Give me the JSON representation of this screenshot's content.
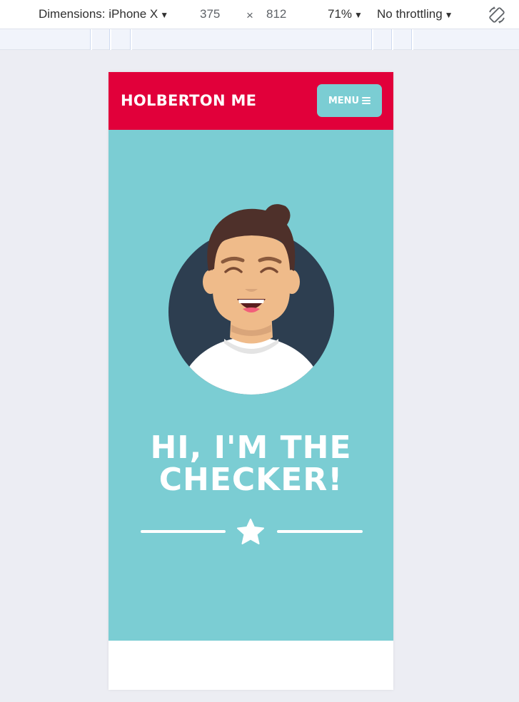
{
  "devtools": {
    "device_label": "Dimensions: iPhone X",
    "width_value": "375",
    "times_sign": "×",
    "height_value": "812",
    "zoom_label": "71%",
    "throttle_label": "No throttling",
    "rotate_icon": "rotate-icon"
  },
  "site": {
    "brand": "HOLBERTON ME",
    "menu_label": "MENU",
    "menu_icon": "hamburger-icon",
    "hero_title": "HI, I'M THE CHECKER!",
    "star_icon": "star-icon",
    "colors": {
      "header": "#e1003a",
      "hero": "#7bcdd3",
      "avatar_bg": "#2d3e50",
      "text": "#ffffff"
    }
  }
}
